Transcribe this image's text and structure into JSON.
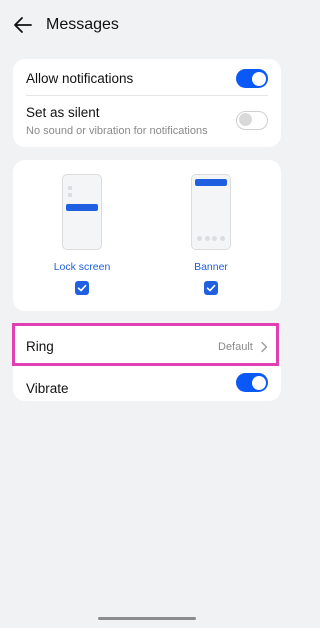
{
  "header": {
    "title": "Messages"
  },
  "notifications": {
    "allow_label": "Allow notifications",
    "allow_on": true,
    "silent_label": "Set as silent",
    "silent_sub": "No sound or vibration for notifications",
    "silent_on": false
  },
  "styles": {
    "lock_screen_label": "Lock screen",
    "lock_screen_checked": true,
    "banner_label": "Banner",
    "banner_checked": true
  },
  "ring": {
    "label": "Ring",
    "value": "Default"
  },
  "vibrate": {
    "label": "Vibrate",
    "on": true
  },
  "colors": {
    "accent": "#0a59f7",
    "highlight": "#e040b3"
  }
}
